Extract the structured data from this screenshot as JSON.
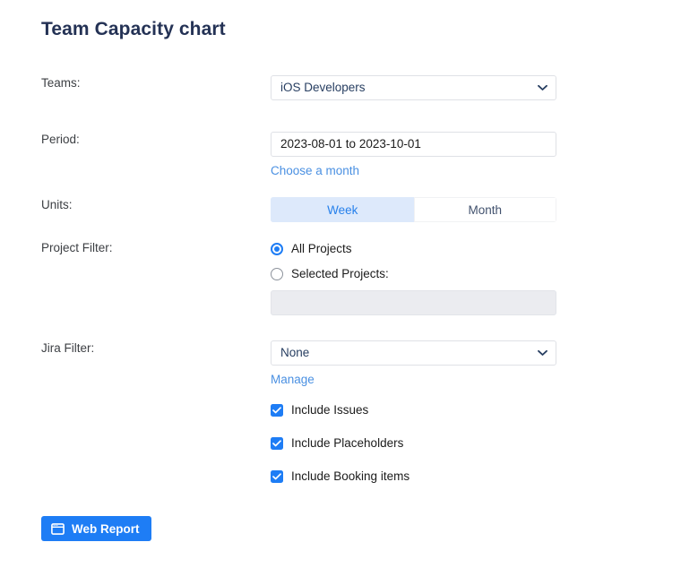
{
  "page": {
    "title": "Team Capacity chart"
  },
  "form": {
    "teams": {
      "label": "Teams:",
      "selected": "iOS Developers",
      "options": [
        "iOS Developers"
      ]
    },
    "period": {
      "label": "Period:",
      "value": "2023-08-01 to 2023-10-01",
      "choose_month_link": "Choose a month"
    },
    "units": {
      "label": "Units:",
      "options": [
        {
          "label": "Week",
          "selected": true
        },
        {
          "label": "Month",
          "selected": false
        }
      ]
    },
    "project_filter": {
      "label": "Project Filter:",
      "options": [
        {
          "label": "All Projects",
          "selected": true
        },
        {
          "label": "Selected Projects:",
          "selected": false
        }
      ],
      "selected_projects_value": ""
    },
    "jira_filter": {
      "label": "Jira Filter:",
      "selected": "None",
      "options": [
        "None"
      ],
      "manage_link": "Manage"
    },
    "include_options": [
      {
        "label": "Include Issues",
        "checked": true
      },
      {
        "label": "Include Placeholders",
        "checked": true
      },
      {
        "label": "Include Booking items",
        "checked": true
      }
    ]
  },
  "actions": {
    "web_report": {
      "label": "Web Report",
      "icon": "browser-window-icon"
    }
  },
  "colors": {
    "accent_blue": "#1E7DF5",
    "link_blue": "#4A90E2",
    "toggle_active_bg": "#DDE9FB",
    "title_navy": "#243255",
    "border_gray": "#DFE1E6",
    "disabled_bg": "#EBECF0"
  }
}
